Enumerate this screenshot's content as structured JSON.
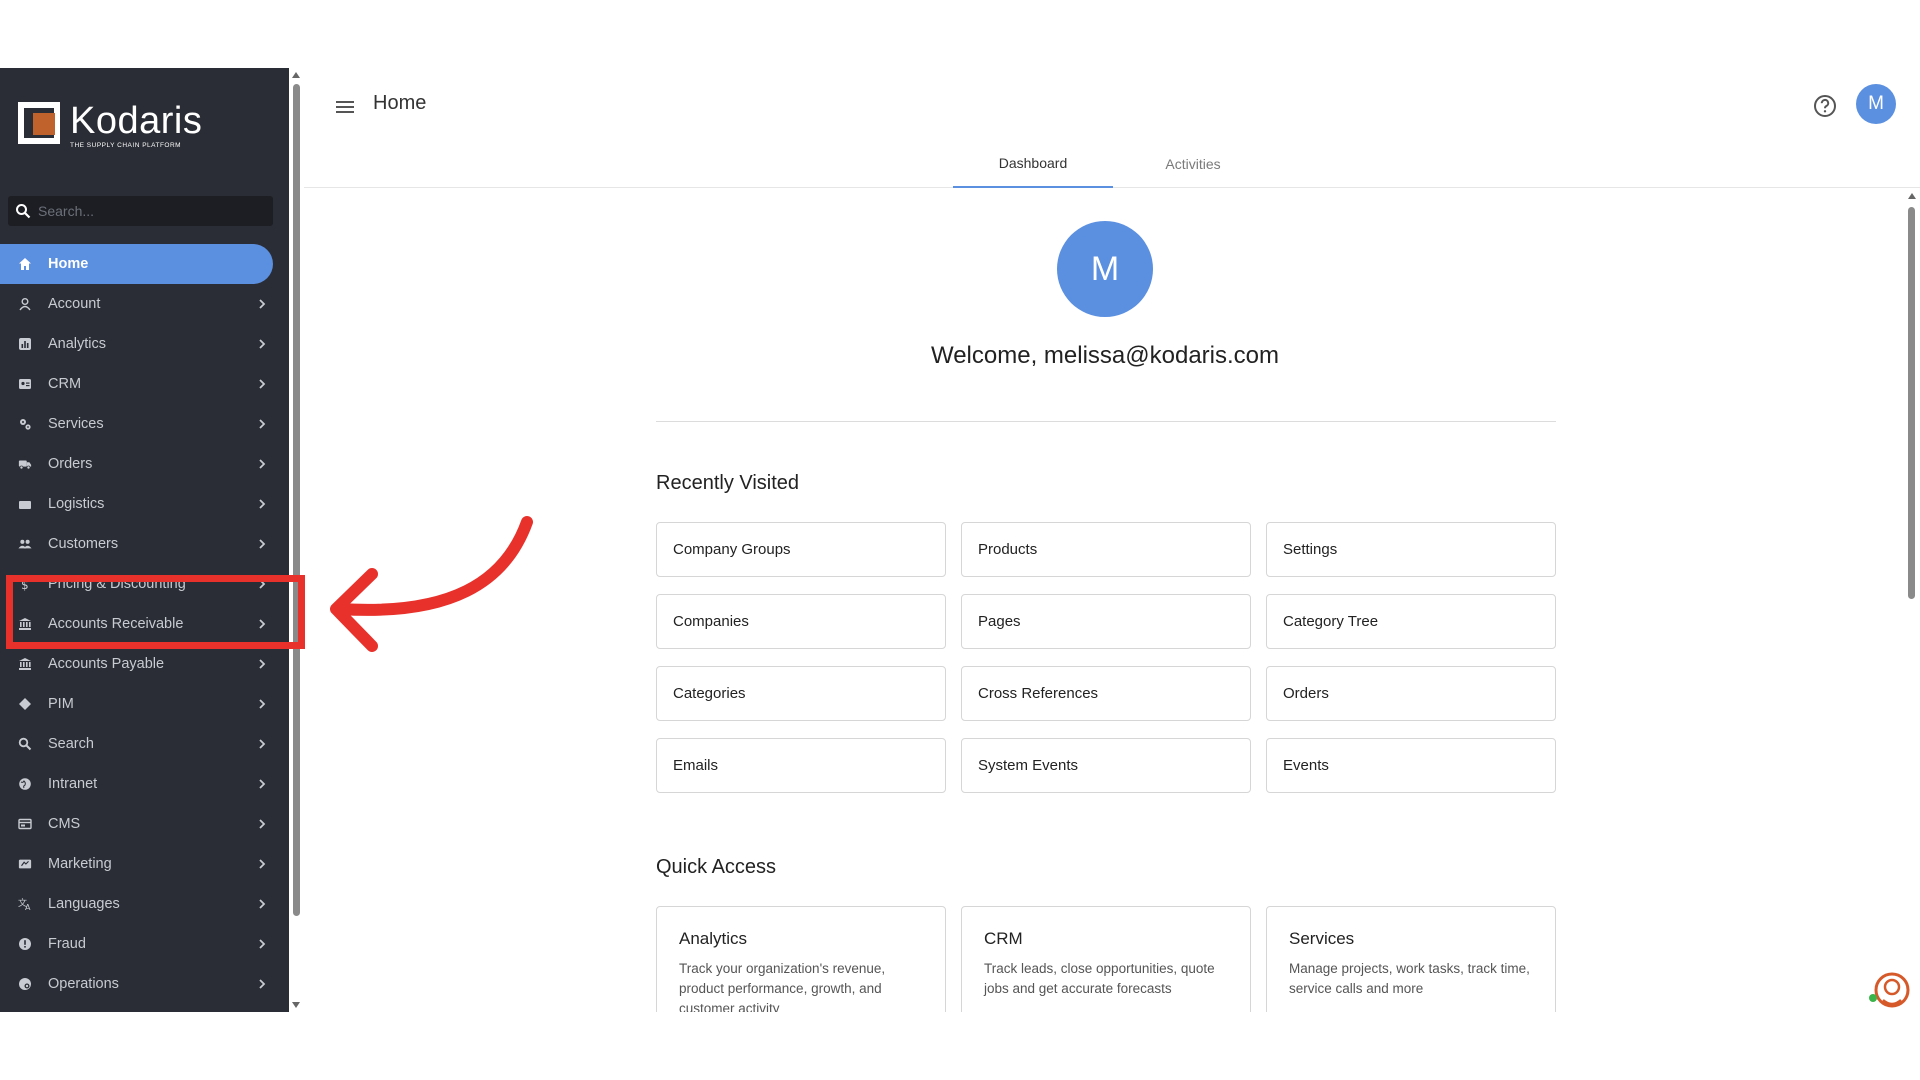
{
  "app": {
    "logo_word": "Kodaris",
    "logo_tagline": "THE SUPPLY CHAIN PLATFORM",
    "brand_color": "#5b8fe0",
    "logo_accent": "#c0622b"
  },
  "sidebar": {
    "search_placeholder": "Search...",
    "items": [
      {
        "label": "Home",
        "icon": "home-icon",
        "active": true
      },
      {
        "label": "Account",
        "icon": "person-icon"
      },
      {
        "label": "Analytics",
        "icon": "analytics-icon"
      },
      {
        "label": "CRM",
        "icon": "crm-icon"
      },
      {
        "label": "Services",
        "icon": "services-icon"
      },
      {
        "label": "Orders",
        "icon": "truck-icon"
      },
      {
        "label": "Logistics",
        "icon": "logistics-icon"
      },
      {
        "label": "Customers",
        "icon": "people-icon"
      },
      {
        "label": "Pricing & Discounting",
        "icon": "dollar-icon"
      },
      {
        "label": "Accounts Receivable",
        "icon": "bank-icon"
      },
      {
        "label": "Accounts Payable",
        "icon": "bank-icon"
      },
      {
        "label": "PIM",
        "icon": "tag-icon"
      },
      {
        "label": "Search",
        "icon": "search-icon"
      },
      {
        "label": "Intranet",
        "icon": "globe-icon"
      },
      {
        "label": "CMS",
        "icon": "cms-icon"
      },
      {
        "label": "Marketing",
        "icon": "marketing-icon"
      },
      {
        "label": "Languages",
        "icon": "translate-icon"
      },
      {
        "label": "Fraud",
        "icon": "alert-icon"
      },
      {
        "label": "Operations",
        "icon": "operations-icon"
      }
    ]
  },
  "header": {
    "title": "Home",
    "avatar_initial": "M",
    "tabs": [
      {
        "label": "Dashboard",
        "active": true
      },
      {
        "label": "Activities",
        "active": false
      }
    ]
  },
  "main": {
    "avatar_initial": "M",
    "welcome": "Welcome, melissa@kodaris.com",
    "recently_visited_title": "Recently Visited",
    "recently_visited": [
      "Company Groups",
      "Products",
      "Settings",
      "Companies",
      "Pages",
      "Category Tree",
      "Categories",
      "Cross References",
      "Orders",
      "Emails",
      "System Events",
      "Events"
    ],
    "quick_access_title": "Quick Access",
    "quick_access": [
      {
        "title": "Analytics",
        "desc": "Track your organization's revenue, product performance, growth, and customer activity"
      },
      {
        "title": "CRM",
        "desc": "Track leads, close opportunities, quote jobs and get accurate forecasts"
      },
      {
        "title": "Services",
        "desc": "Manage projects, work tasks, track time, service calls and more"
      }
    ]
  },
  "annotation": {
    "highlight_color": "#e8312a",
    "target": "Customers"
  }
}
